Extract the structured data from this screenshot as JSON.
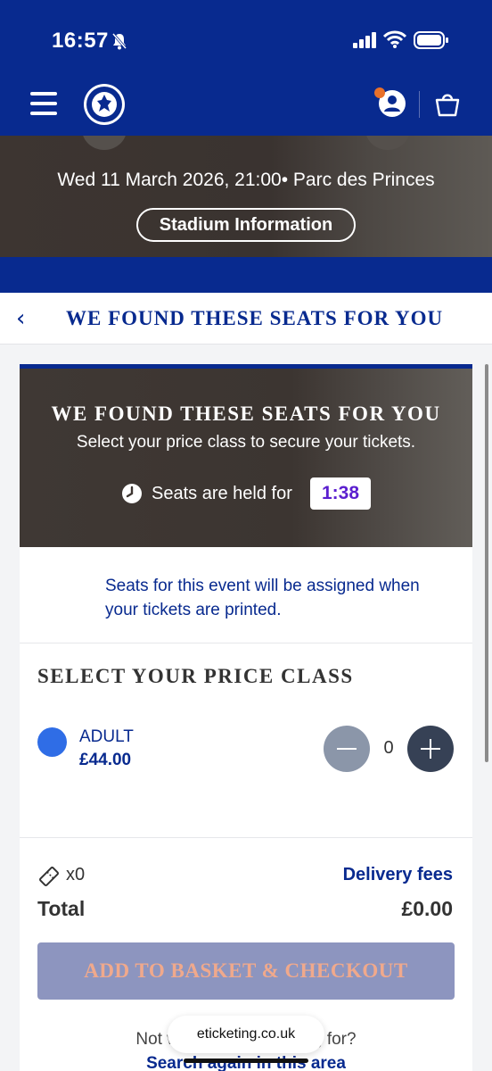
{
  "status_bar": {
    "time": "16:57",
    "icons": [
      "bell-slash-icon",
      "signal-icon",
      "wifi-icon",
      "battery-icon"
    ]
  },
  "nav": {
    "icons": [
      "menu-icon",
      "chelsea-crest-logo",
      "account-icon",
      "basket-icon"
    ],
    "notification_color": "#e8702a"
  },
  "hero": {
    "event_info": "Wed 11 March 2026, 21:00• Parc des Princes",
    "stadium_button": "Stadium Information"
  },
  "title_bar": {
    "back_icon": "chevron-left-icon",
    "title": "WE FOUND THESE SEATS FOR YOU"
  },
  "card": {
    "hero_title": "WE FOUND THESE SEATS FOR YOU",
    "hero_subtitle": "Select your price class to secure your tickets.",
    "held_label": "Seats are held for",
    "timer": "1:38",
    "info_text": "Seats for this event will be assigned when your tickets are printed.",
    "price_class_title": "SELECT YOUR PRICE CLASS",
    "price_classes": [
      {
        "name": "ADULT",
        "price": "£44.00",
        "quantity": "0",
        "color": "#2f6de6"
      }
    ]
  },
  "summary": {
    "ticket_count": "x0",
    "delivery_link": "Delivery fees",
    "total_label": "Total",
    "total_value": "£0.00",
    "checkout_button": "ADD TO BASKET & CHECKOUT",
    "not_what": "Not what you are looking for?",
    "search_again": "Search again in this area"
  },
  "browser": {
    "url": "eticketing.co.uk"
  },
  "colors": {
    "primary": "#082a8f",
    "timer_text": "#5b1fcf",
    "disabled_button": "#8d95bf"
  }
}
